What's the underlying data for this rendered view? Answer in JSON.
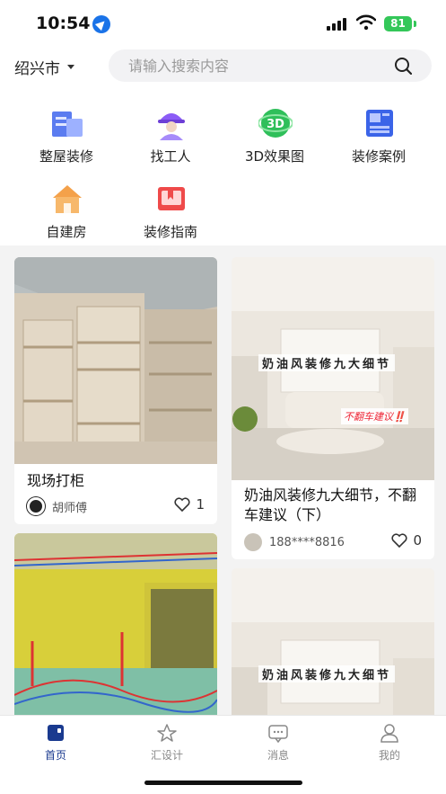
{
  "status_bar": {
    "time": "10:54",
    "battery": "81"
  },
  "header": {
    "city": "绍兴市",
    "search_placeholder": "请输入搜索内容"
  },
  "categories": [
    {
      "label": "整屋装修",
      "icon": "whole-house-icon"
    },
    {
      "label": "找工人",
      "icon": "worker-icon"
    },
    {
      "label": "3D效果图",
      "icon": "3d-render-icon"
    },
    {
      "label": "装修案例",
      "icon": "case-icon"
    },
    {
      "label": "自建房",
      "icon": "self-build-house-icon"
    },
    {
      "label": "装修指南",
      "icon": "guide-book-icon"
    }
  ],
  "feed": [
    {
      "title": "现场打柜",
      "author": "胡师傅",
      "likes": "1"
    },
    {
      "title": "奶油风装修九大细节，不翻车建议（下）",
      "author": "188****8816",
      "likes": "0",
      "overlay": "奶油风装修九大细节",
      "overlay_tag": "不翻车建议‼️"
    },
    {
      "title": "",
      "author": "",
      "likes": ""
    },
    {
      "title": "",
      "author": "",
      "likes": "",
      "overlay": "奶油风装修九大细节"
    }
  ],
  "tabs": [
    {
      "label": "首页",
      "icon": "home-icon",
      "active": true
    },
    {
      "label": "汇设计",
      "icon": "design-icon",
      "active": false
    },
    {
      "label": "消息",
      "icon": "message-icon",
      "active": false
    },
    {
      "label": "我的",
      "icon": "profile-icon",
      "active": false
    }
  ],
  "colors": {
    "accent": "#1a3a8f",
    "battery": "#34c759",
    "background": "#f3f3f3"
  }
}
